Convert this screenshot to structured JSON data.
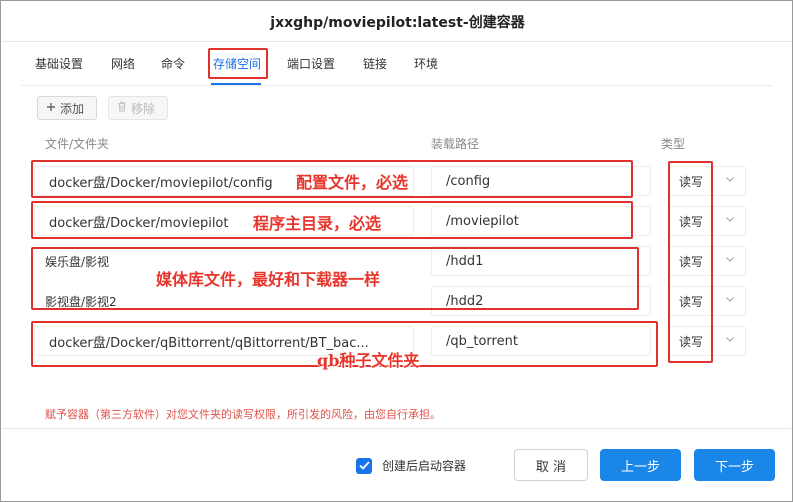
{
  "window": {
    "title": "jxxghp/moviepilot:latest-创建容器"
  },
  "tabs": [
    {
      "label": "基础设置",
      "active": false
    },
    {
      "label": "网络",
      "active": false
    },
    {
      "label": "命令",
      "active": false
    },
    {
      "label": "存储空间",
      "active": true
    },
    {
      "label": "端口设置",
      "active": false
    },
    {
      "label": "链接",
      "active": false
    },
    {
      "label": "环境",
      "active": false
    }
  ],
  "toolbar": {
    "add_label": "添加",
    "remove_label": "移除"
  },
  "columns": {
    "folder": "文件/文件夹",
    "mount_path": "装载路径",
    "type": "类型"
  },
  "volumes": [
    {
      "folder": "docker盘/Docker/moviepilot/config",
      "mount": "/config",
      "type": "读写"
    },
    {
      "folder": "docker盘/Docker/moviepilot",
      "mount": "/moviepilot",
      "type": "读写"
    },
    {
      "folder": "娱乐盘/影视",
      "mount": "/hdd1",
      "type": "读写"
    },
    {
      "folder": "影视盘/影视2",
      "mount": "/hdd2",
      "type": "读写"
    },
    {
      "folder": "docker盘/Docker/qBittorrent/qBittorrent/BT_bac...",
      "mount": "/qb_torrent",
      "type": "读写"
    }
  ],
  "annotations": {
    "config": "配置文件，必选",
    "main_dir": "程序主目录，必选",
    "media": "媒体库文件，最好和下载器一样",
    "qb": "qb种子文件夹"
  },
  "warning": "赋予容器（第三方软件）对您文件夹的读写权限，所引发的风险，由您自行承担。",
  "footer": {
    "checkbox_label": "创建后启动容器",
    "checkbox_checked": true,
    "cancel_label": "取 消",
    "prev_label": "上一步",
    "next_label": "下一步"
  },
  "colors": {
    "accent": "#1a87e8",
    "annotation_red": "#e0322c",
    "warning_text": "#e0524a"
  }
}
